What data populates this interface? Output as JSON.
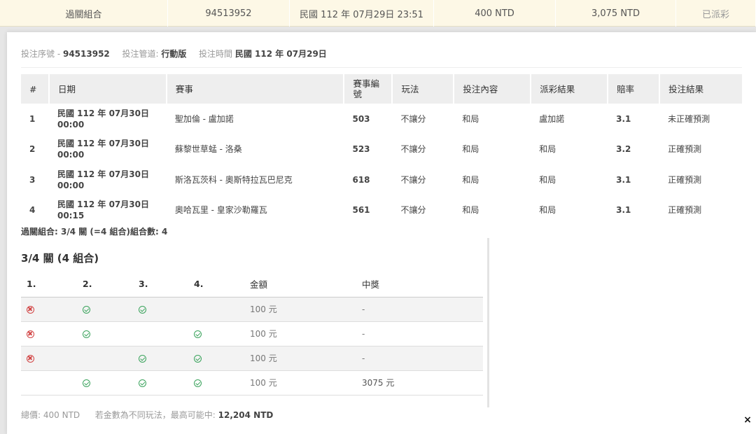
{
  "summary": {
    "type": "過關組合",
    "serial": "94513952",
    "datetime": "民國 112 年 07月29日 23:51",
    "stake": "400 NTD",
    "payout": "3,075 NTD",
    "status": "已派彩"
  },
  "meta": {
    "serial_label": "投注序號 -",
    "serial_value": "94513952",
    "channel_label": "投注管道:",
    "channel_value": "行動版",
    "time_label": "投注時間",
    "time_value": "民國 112 年 07月29日"
  },
  "matches": {
    "headers": [
      "#",
      "日期",
      "賽事",
      "賽事編號",
      "玩法",
      "投注內容",
      "派彩結果",
      "賠率",
      "投注結果"
    ],
    "rows": [
      {
        "no": "1",
        "date": "民國 112 年 07月30日",
        "time": "00:00",
        "event": "聖加倫 - 盧加諾",
        "code": "503",
        "play": "不讓分",
        "pick": "和局",
        "result": "盧加諾",
        "odds": "3.1",
        "outcome": "未正確預測"
      },
      {
        "no": "2",
        "date": "民國 112 年 07月30日",
        "time": "00:00",
        "event": "蘇黎世草蜢 - 洛桑",
        "code": "523",
        "play": "不讓分",
        "pick": "和局",
        "result": "和局",
        "odds": "3.2",
        "outcome": "正確預測"
      },
      {
        "no": "3",
        "date": "民國 112 年 07月30日",
        "time": "00:00",
        "event": "斯洛瓦茨科 - 奧斯特拉瓦巴尼克",
        "code": "618",
        "play": "不讓分",
        "pick": "和局",
        "result": "和局",
        "odds": "3.1",
        "outcome": "正確預測"
      },
      {
        "no": "4",
        "date": "民國 112 年 07月30日",
        "time": "00:15",
        "event": "奧哈瓦里 - 皇家沙勒羅瓦",
        "code": "561",
        "play": "不讓分",
        "pick": "和局",
        "result": "和局",
        "odds": "3.1",
        "outcome": "正確預測"
      }
    ]
  },
  "combo_summary": "過關組合: 3/4 關 (=4 組合)組合數: 4",
  "combo": {
    "title": "3/4 關 (4 組合)",
    "headers": [
      "1.",
      "2.",
      "3.",
      "4.",
      "金額",
      "中獎"
    ],
    "rows": [
      {
        "c1": "x",
        "c2": "ok",
        "c3": "ok",
        "c4": "",
        "amount": "100 元",
        "win": "-"
      },
      {
        "c1": "x",
        "c2": "ok",
        "c3": "",
        "c4": "ok",
        "amount": "100 元",
        "win": "-"
      },
      {
        "c1": "x",
        "c2": "",
        "c3": "ok",
        "c4": "ok",
        "amount": "100 元",
        "win": "-"
      },
      {
        "c1": "",
        "c2": "ok",
        "c3": "ok",
        "c4": "ok",
        "amount": "100 元",
        "win": "3075 元"
      }
    ]
  },
  "footer": {
    "total_label": "總價:",
    "total_value": "400 NTD",
    "max_label": "若金數為不同玩法，最高可能中:",
    "max_value": "12,204 NTD"
  },
  "close_glyph": "×",
  "colors": {
    "fail": "#d24545",
    "success": "#3aa35c",
    "topbar_bg": "#fdf8e6"
  }
}
